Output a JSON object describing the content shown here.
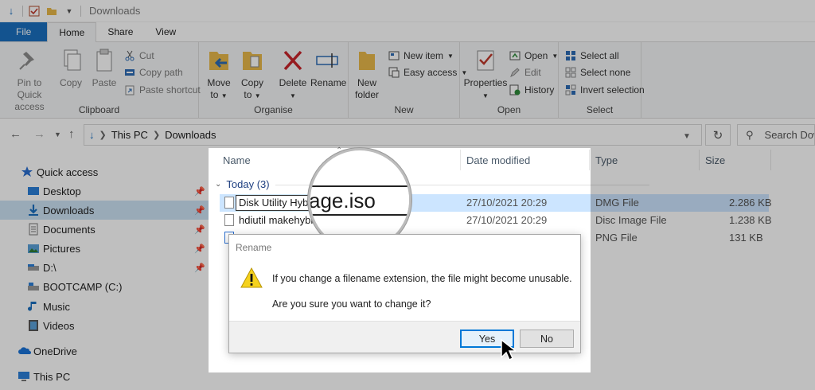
{
  "titlebar": {
    "title": "Downloads"
  },
  "ribbon_tabs": [
    "File",
    "Home",
    "Share",
    "View"
  ],
  "ribbon": {
    "clipboard": {
      "label": "Clipboard",
      "pin_label_1": "Pin to Quick",
      "pin_label_2": "access",
      "copy": "Copy",
      "paste": "Paste",
      "cut": "Cut",
      "copy_path": "Copy path",
      "paste_shortcut": "Paste shortcut"
    },
    "organise": {
      "label": "Organise",
      "move_to_1": "Move",
      "move_to_2": "to",
      "copy_to_1": "Copy",
      "copy_to_2": "to",
      "delete": "Delete",
      "rename": "Rename"
    },
    "new": {
      "label": "New",
      "new_folder_1": "New",
      "new_folder_2": "folder",
      "new_item": "New item",
      "easy_access": "Easy access"
    },
    "open": {
      "label": "Open",
      "properties": "Properties",
      "open": "Open",
      "edit": "Edit",
      "history": "History"
    },
    "select": {
      "label": "Select",
      "select_all": "Select all",
      "select_none": "Select none",
      "invert_selection": "Invert selection"
    }
  },
  "address": {
    "crumb1": "This PC",
    "crumb2": "Downloads",
    "search_placeholder": "Search Dow"
  },
  "navpane": {
    "items": [
      {
        "label": "Quick access",
        "icon": "star-icon"
      },
      {
        "label": "Desktop",
        "icon": "desktop-icon"
      },
      {
        "label": "Downloads",
        "icon": "download-arrow-icon"
      },
      {
        "label": "Documents",
        "icon": "documents-icon"
      },
      {
        "label": "Pictures",
        "icon": "pictures-icon"
      },
      {
        "label": "D:\\",
        "icon": "drive-icon"
      },
      {
        "label": "BOOTCAMP (C:)",
        "icon": "drive-icon"
      },
      {
        "label": "Music",
        "icon": "music-icon"
      },
      {
        "label": "Videos",
        "icon": "videos-icon"
      },
      {
        "label": "OneDrive",
        "icon": "cloud-icon"
      },
      {
        "label": "This PC",
        "icon": "computer-icon"
      }
    ]
  },
  "columns": {
    "name": "Name",
    "date": "Date modified",
    "type": "Type",
    "size": "Size"
  },
  "group": {
    "label": "Today (3)"
  },
  "files": [
    {
      "name": "Disk Utility Hybr",
      "date": "27/10/2021 20:29",
      "type": "DMG File",
      "size": "2.286 KB"
    },
    {
      "name": "hdiutil makehybr",
      "date": "27/10/2021 20:29",
      "type": "Disc Image File",
      "size": "1.238 KB"
    },
    {
      "name": "",
      "date": "",
      "type": "PNG File",
      "size": "131 KB"
    }
  ],
  "magnifier": {
    "text": "age.iso"
  },
  "dialog": {
    "title": "Rename",
    "message1": "If you change a filename extension, the file might become unusable.",
    "message2": "Are you sure you want to change it?",
    "yes": "Yes",
    "no": "No"
  },
  "colors": {
    "accent": "#1a6fbf",
    "selection": "#cce5ff",
    "warning": "#f5d21d"
  }
}
